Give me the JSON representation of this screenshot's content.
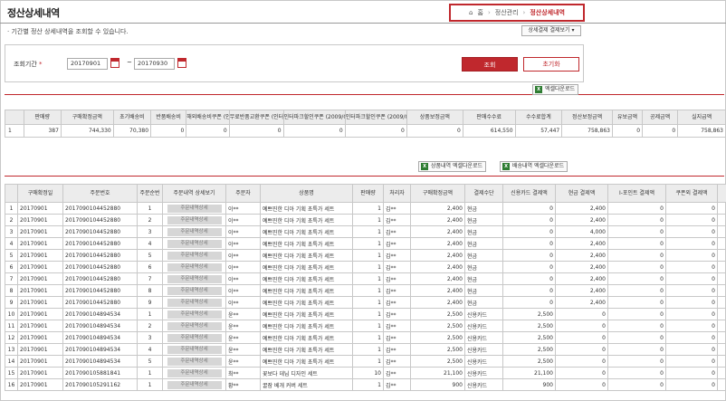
{
  "header": {
    "title": "정산상세내역",
    "breadcrumb": [
      "홈",
      "정산관리",
      "정산상세내역"
    ]
  },
  "description": "· 기간별 정산 상세내역을 조회할 수 있습니다.",
  "select_button": "상세결제 결제보기",
  "search": {
    "label": "조회기간",
    "required_mark": "*",
    "start_date": "20170901",
    "end_date": "20170930",
    "tilde": "~",
    "search_button": "조회",
    "reset_button": "초기화"
  },
  "summary_excel_button": "엑셀다운로드",
  "summary": {
    "headers": [
      "판매량",
      "구매확정금액",
      "초기배송비",
      "반품배송비",
      "해외배송비쿠폰 (인터파크)",
      "무료반품교환쿠폰 (인터파크)",
      "인터파크할인쿠폰 (2009/04/09이전)",
      "인터파크할인쿠폰 (2009/04/09이후)",
      "상품보정금액",
      "판매수수료",
      "수수료합계",
      "정산보정금액",
      "유보금액",
      "공제금액",
      "실지급액"
    ],
    "row": [
      "1",
      "387",
      "744,330",
      "70,380",
      "0",
      "0",
      "0",
      "0",
      "0",
      "0",
      "614,550",
      "57,447",
      "758,863",
      "0",
      "0",
      "758,863"
    ]
  },
  "detail_excel_buttons": [
    "상품내역 엑셀다운로드",
    "배송내역 엑셀다운로드"
  ],
  "detail": {
    "headers": [
      "",
      "구매확정일",
      "주문번호",
      "주문순번",
      "주문내역 상세보기",
      "주문자",
      "상품명",
      "판매량",
      "처리자",
      "구매확정금액",
      "결제수단",
      "신용카드 결제액",
      "현금 결제액",
      "I-포인트 결제액",
      "쿠폰외 결제액"
    ],
    "view_label": "주문내역상세",
    "rows": [
      [
        "1",
        "20170901",
        "2017090104452880",
        "1",
        "이**",
        "예쁘진한 디아 기획 초특가 세트",
        "1",
        "김**",
        "2,400",
        "현금",
        "0",
        "2,400",
        "0",
        "0"
      ],
      [
        "2",
        "20170901",
        "2017090104452880",
        "2",
        "이**",
        "예쁘진한 디아 기획 초특가 세트",
        "1",
        "김**",
        "2,400",
        "현금",
        "0",
        "2,400",
        "0",
        "0"
      ],
      [
        "3",
        "20170901",
        "2017090104452880",
        "3",
        "이**",
        "예쁘진한 디아 기획 초특가 세트",
        "1",
        "김**",
        "2,400",
        "현금",
        "0",
        "4,000",
        "0",
        "0"
      ],
      [
        "4",
        "20170901",
        "2017090104452880",
        "4",
        "이**",
        "예쁘진한 디아 기획 초특가 세트",
        "1",
        "김**",
        "2,400",
        "현금",
        "0",
        "2,400",
        "0",
        "0"
      ],
      [
        "5",
        "20170901",
        "2017090104452880",
        "5",
        "이**",
        "예쁘진한 디아 기획 초특가 세트",
        "1",
        "김**",
        "2,400",
        "현금",
        "0",
        "2,400",
        "0",
        "0"
      ],
      [
        "6",
        "20170901",
        "2017090104452880",
        "6",
        "이**",
        "예쁘진한 디아 기획 초특가 세트",
        "1",
        "김**",
        "2,400",
        "현금",
        "0",
        "2,400",
        "0",
        "0"
      ],
      [
        "7",
        "20170901",
        "2017090104452880",
        "7",
        "이**",
        "예쁘진한 디아 기획 초특가 세트",
        "1",
        "김**",
        "2,400",
        "현금",
        "0",
        "2,400",
        "0",
        "0"
      ],
      [
        "8",
        "20170901",
        "2017090104452880",
        "8",
        "이**",
        "예쁘진한 디아 기획 초특가 세트",
        "1",
        "김**",
        "2,400",
        "현금",
        "0",
        "2,400",
        "0",
        "0"
      ],
      [
        "9",
        "20170901",
        "2017090104452880",
        "9",
        "이**",
        "예쁘진한 디아 기획 초특가 세트",
        "1",
        "김**",
        "2,400",
        "현금",
        "0",
        "2,400",
        "0",
        "0"
      ],
      [
        "10",
        "20170901",
        "2017090104894534",
        "1",
        "윤**",
        "예쁘진한 디아 기획 초특가 세트",
        "1",
        "김**",
        "2,500",
        "신용카드",
        "2,500",
        "0",
        "0",
        "0"
      ],
      [
        "11",
        "20170901",
        "2017090104894534",
        "2",
        "윤**",
        "예쁘진한 디아 기획 초특가 세트",
        "1",
        "김**",
        "2,500",
        "신용카드",
        "2,500",
        "0",
        "0",
        "0"
      ],
      [
        "12",
        "20170901",
        "2017090104894534",
        "3",
        "윤**",
        "예쁘진한 디아 기획 초특가 세트",
        "1",
        "김**",
        "2,500",
        "신용카드",
        "2,500",
        "0",
        "0",
        "0"
      ],
      [
        "13",
        "20170901",
        "2017090104894534",
        "4",
        "윤**",
        "예쁘진한 디아 기획 초특가 세트",
        "1",
        "김**",
        "2,500",
        "신용카드",
        "2,500",
        "0",
        "0",
        "0"
      ],
      [
        "14",
        "20170901",
        "2017090104894534",
        "5",
        "윤**",
        "예쁘진한 디아 기획 초특가 세트",
        "1",
        "김**",
        "2,500",
        "신용카드",
        "2,500",
        "0",
        "0",
        "0"
      ],
      [
        "15",
        "20170901",
        "2017090105881841",
        "1",
        "최**",
        "꽃보다 데님 디자인 세트",
        "10",
        "김**",
        "21,100",
        "신용카드",
        "21,100",
        "0",
        "0",
        "0"
      ],
      [
        "16",
        "20170901",
        "2017090105291162",
        "1",
        "황**",
        "꿀잠 베개 커버 세트",
        "1",
        "김**",
        "900",
        "신용카드",
        "900",
        "0",
        "0",
        "0"
      ]
    ]
  }
}
